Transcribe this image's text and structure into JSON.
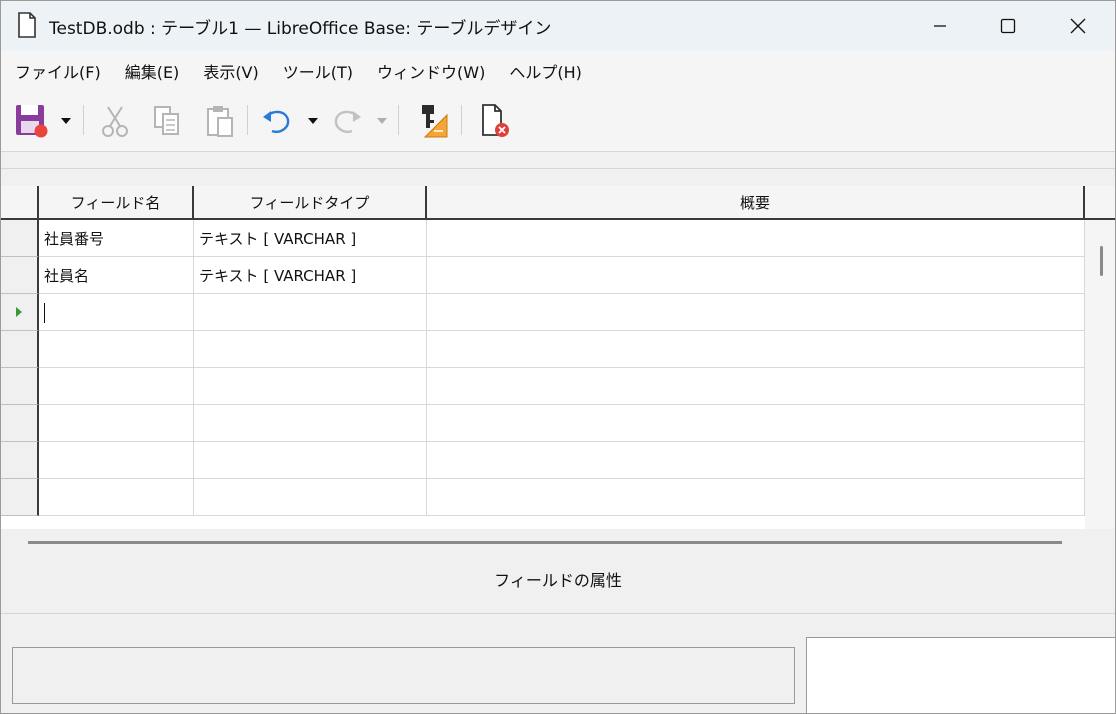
{
  "window": {
    "title": "TestDB.odb : テーブル1 — LibreOffice Base: テーブルデザイン"
  },
  "menu": [
    {
      "label": "ファイル(F)"
    },
    {
      "label": "編集(E)"
    },
    {
      "label": "表示(V)"
    },
    {
      "label": "ツール(T)"
    },
    {
      "label": "ウィンドウ(W)"
    },
    {
      "label": "ヘルプ(H)"
    }
  ],
  "toolbar": {
    "icons": [
      "save-icon",
      "cut-icon",
      "copy-icon",
      "paste-icon",
      "undo-icon",
      "redo-icon",
      "primary-key-icon",
      "close-document-icon"
    ]
  },
  "grid": {
    "headers": {
      "field_name": "フィールド名",
      "field_type": "フィールドタイプ",
      "description": "概要"
    },
    "rows": [
      {
        "name": "社員番号",
        "type": "テキスト [ VARCHAR ]",
        "description": ""
      },
      {
        "name": "社員名",
        "type": "テキスト [ VARCHAR ]",
        "description": ""
      },
      {
        "name": "",
        "type": "",
        "description": "",
        "current": true
      },
      {
        "name": "",
        "type": "",
        "description": ""
      },
      {
        "name": "",
        "type": "",
        "description": ""
      },
      {
        "name": "",
        "type": "",
        "description": ""
      },
      {
        "name": "",
        "type": "",
        "description": ""
      },
      {
        "name": "",
        "type": "",
        "description": ""
      }
    ]
  },
  "properties": {
    "label": "フィールドの属性"
  },
  "colors": {
    "titlebar": "#ecf2f5",
    "current_row_marker": "#3a9a3a",
    "save_icon": "#8a3c9c"
  }
}
